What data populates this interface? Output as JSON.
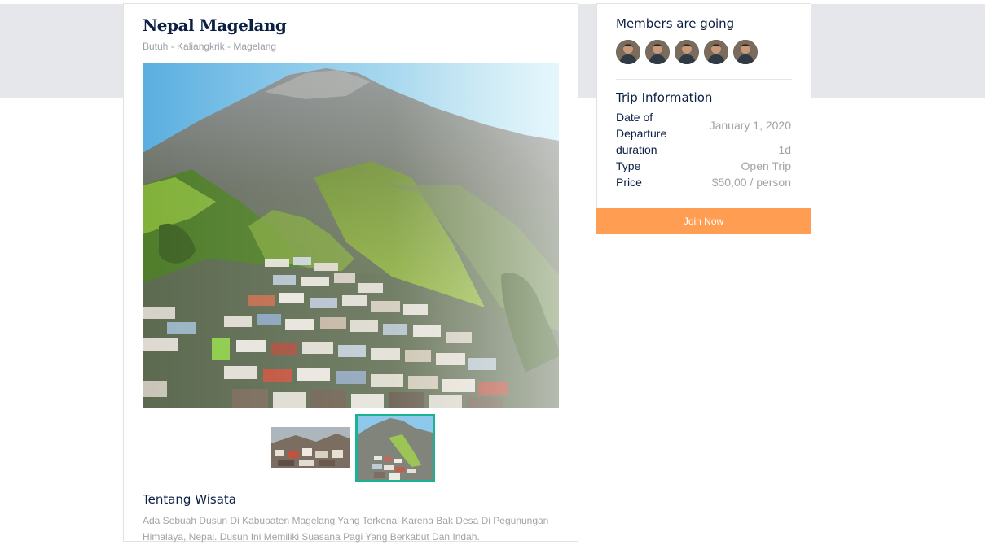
{
  "listing": {
    "title": "Nepal Magelang",
    "location": "Butuh - Kaliangkrik - Magelang"
  },
  "gallery": {
    "thumbnails": [
      {
        "name": "village-panorama"
      },
      {
        "name": "mountain-village",
        "selected": true
      }
    ],
    "selected_color": "#1bb195"
  },
  "about": {
    "title": "Tentang Wisata",
    "text": "Ada Sebuah Dusun Di Kabupaten Magelang Yang Terkenal Karena Bak Desa Di Pegunungan Himalaya, Nepal. Dusun Ini Memiliki Suasana Pagi Yang Berkabut Dan Indah."
  },
  "members": {
    "title": "Members are going",
    "count": 5
  },
  "trip": {
    "title": "Trip Information",
    "rows": [
      {
        "label": "Date of Departure",
        "value": "January 1, 2020"
      },
      {
        "label": "duration",
        "value": "1d"
      },
      {
        "label": "Type",
        "value": "Open Trip"
      },
      {
        "label": "Price",
        "value": "$50,00 / person"
      }
    ]
  },
  "actions": {
    "join_label": "Join Now",
    "join_color": "#ff9e53"
  }
}
